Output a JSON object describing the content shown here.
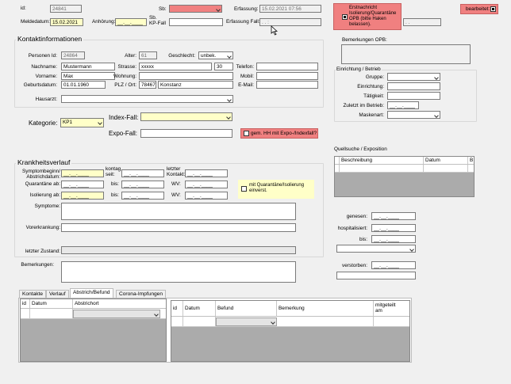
{
  "header": {
    "id_label": "id:",
    "id_value": "24841",
    "sb_label": "Sb:",
    "erfassung_label": "Erfassung:",
    "erfassung_value": "15.02.2021 07:56",
    "meldedatum_label": "Meldedatum:",
    "meldedatum_value": "15.02.2021",
    "anhoerung_label": "Anhörung:",
    "anhoerung_value": "__.__.____",
    "sb_kp_fall_label": "Sb.\nKP-Fall",
    "erfassung_fall_label": "Erfassung Fall:",
    "erfassung_fall_value": ". .   :",
    "erstnachricht_text": "Erstnachricht Isolierung/Quarantäne OPB (bitte Haken belassen).",
    "erstnachricht_date": ". .",
    "bearbeitet_label": "bearbeitet:",
    "colors": {
      "alert": "#f08080",
      "highlight": "#ffffc8"
    }
  },
  "kontakt": {
    "title": "Kontaktinformationen",
    "person_id_label": "Personen Id:",
    "person_id_value": "24864",
    "alter_label": "Alter:",
    "alter_value": "61",
    "geschlecht_label": "Geschlecht:",
    "geschlecht_value": "unbek.",
    "nachname_label": "Nachname:",
    "nachname_value": "Mustermann",
    "strasse_label": "Strasse:",
    "strasse_value": "xxxxx",
    "hausnr_value": "30",
    "telefon_label": "Telefon:",
    "vorname_label": "Vorname:",
    "vorname_value": "Max",
    "wohnung_label": "Wohnung:",
    "mobil_label": "Mobil:",
    "geburtsdatum_label": "Geburtsdatum:",
    "geburtsdatum_value": "01.01.1960",
    "plz_ort_label": "PLZ / Ort:",
    "plz_value": "78467",
    "ort_value": "Konstanz",
    "email_label": "E-Mail:",
    "hausarzt_label": "Hausarzt:"
  },
  "opb": {
    "bemerkungen_label": "Bemerkungen OPB:"
  },
  "einrichtung": {
    "title": "Einrichtung / Betrieb",
    "gruppe_label": "Gruppe:",
    "einrichtung_label": "Einrichtung:",
    "taetigkeit_label": "Tätigkeit:",
    "zuletzt_label": "Zuletzt im Betrieb:",
    "zuletzt_value": "__.__.____",
    "maskenart_label": "Maskenart:"
  },
  "kategorie": {
    "label": "Kategorie:",
    "value": "KP1",
    "index_fall_label": "Index-Fall:",
    "expo_fall_label": "Expo-Fall:",
    "gem_hh_label": "gem. HH mit Expo-/Indexfall?"
  },
  "quellsuche": {
    "title": "Quellsuche / Exposition",
    "columns": [
      "Beschreibung",
      "Datum",
      "B"
    ]
  },
  "status": {
    "genesen_label": "genesen:",
    "genesen_value": "__.__.____",
    "hospitalisiert_label": "hospitalisiert:",
    "hospitalisiert_value": "__.__.____",
    "bis_label": "bis:",
    "bis_value": "__.__.____",
    "verstorben_label": "verstorben:",
    "verstorben_value": "__.__.____"
  },
  "krankheit": {
    "title": "Krankheitsverlauf",
    "symptombeginn_label": "Symptombeginn/\nAbstrichdatum:",
    "symptombeginn_value": "__.__.____",
    "kontagioes_label": "kontag.\nseit:",
    "kontagioes_value": "__.__.____",
    "letzter_kontakt_label": "letzter\nKontakt:",
    "letzter_kontakt_value": "__.__.____",
    "quarantaene_label": "Quarantäne ab:",
    "quarantaene_value": "__.__.____",
    "bis_label": "bis:",
    "bis_value": "__.__.____",
    "wv_label": "WV:",
    "wv_value": "__.__.____",
    "isolierung_label": "Isolierung ab:",
    "isolierung_value": "__.__.____",
    "bis2_value": "__.__.____",
    "wv2_value": "__.__.____",
    "mit_quarantaene_label": "mit Quarantäne/Isolierung einverst.",
    "symptome_label": "Symptome:",
    "vorerkrankung_label": "Vorerkrankung:",
    "letzter_zustand_label": "letzter Zustand:"
  },
  "bemerkungen_label": "Bemerkungen:",
  "tabs": [
    {
      "label": "Kontakte"
    },
    {
      "label": "Verlauf"
    },
    {
      "label": "Abstrich/Befund"
    },
    {
      "label": "Corona-Impfungen"
    }
  ],
  "abstrich_table": {
    "columns": [
      "id",
      "Datum",
      "Abstrichort"
    ]
  },
  "befund_table": {
    "columns": [
      "id",
      "Datum",
      "Befund",
      "Bemerkung",
      "mitgeteilt\nam"
    ]
  }
}
